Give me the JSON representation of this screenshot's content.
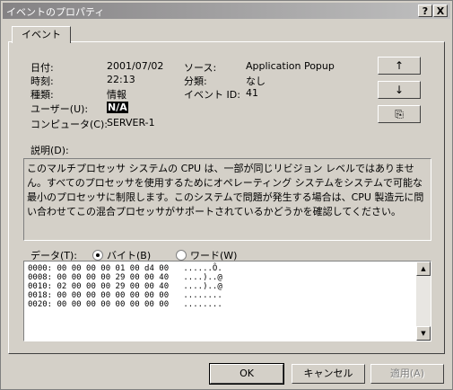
{
  "window": {
    "title": "イベントのプロパティ",
    "help_button": "?",
    "close_button": "X"
  },
  "tab": {
    "label": "イベント"
  },
  "fields": {
    "date_label": "日付:",
    "date_value": "2001/07/02",
    "time_label": "時刻:",
    "time_value": "22:13",
    "type_label": "種類:",
    "type_value": "情報",
    "user_label": "ユーザー(U):",
    "user_value": "N/A",
    "computer_label": "コンピュータ(C):",
    "computer_value": "SERVER-1",
    "source_label": "ソース:",
    "source_value": "Application Popup",
    "category_label": "分類:",
    "category_value": "なし",
    "event_id_label": "イベント ID:",
    "event_id_value": "41"
  },
  "side_buttons": {
    "up": "↑",
    "down": "↓",
    "copy": "⎘"
  },
  "description": {
    "label": "説明(D):",
    "text": "このマルチプロセッサ システムの CPU は、一部が同じリビジョン レベルではありません。すべてのプロセッサを使用するためにオペレーティング システムをシステムで可能な最小のプロセッサに制限します。このシステムで問題が発生する場合は、CPU 製造元に問い合わせてこの混合プロセッサがサポートされているかどうかを確認してください。"
  },
  "data": {
    "label": "データ(T):",
    "radio_bytes": "バイト(B)",
    "radio_words": "ワード(W)",
    "selected": "bytes",
    "lines": "0000: 00 00 00 00 01 00 d4 00   ......Ô.\n0008: 00 00 00 00 29 00 00 40   ....)..@\n0010: 02 00 00 00 29 00 00 40   ....)..@\n0018: 00 00 00 00 00 00 00 00   ........\n0020: 00 00 00 00 00 00 00 00   ........"
  },
  "buttons": {
    "ok": "OK",
    "cancel": "キャンセル",
    "apply": "適用(A)"
  },
  "colors": {
    "face": "#d4d0c8",
    "title_start": "#848284",
    "title_end": "#c0c0c0"
  }
}
